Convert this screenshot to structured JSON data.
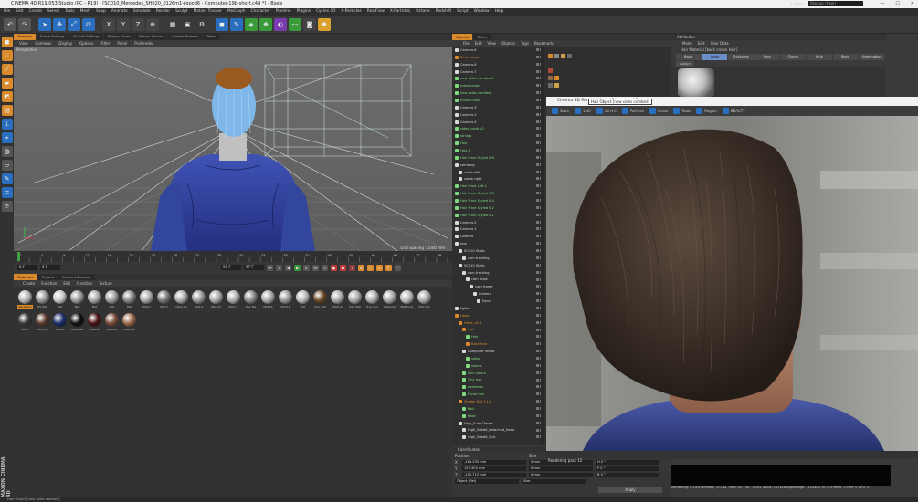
{
  "window": {
    "title": "CINEMA 4D R19.053 Studio (RC - R19) - [SC010_Mercedes_SH020_0126m1+good6 - Computer-19b-short.c4d *] - Basis"
  },
  "menubar": [
    "File",
    "Edit",
    "Create",
    "Select",
    "Tools",
    "Mesh",
    "Snap",
    "Animate",
    "Simulate",
    "Render",
    "Sculpt",
    "Motion Tracker",
    "MoGraph",
    "Character",
    "Pipeline",
    "Plugins",
    "Cycles 4D",
    "X-Particles",
    "RealFlow",
    "X-Particles",
    "Octane",
    "Redshift",
    "Script",
    "Window",
    "Help"
  ],
  "layout": {
    "label": "Layout:",
    "value": "Startup (User)"
  },
  "toolbar": {
    "icons": [
      "undo-icon",
      "redo-icon",
      "pointer-icon",
      "move-icon",
      "scale-icon",
      "rotate-icon",
      "x-axis-icon",
      "y-axis-icon",
      "z-axis-icon",
      "world-coord-icon",
      "render-region-icon",
      "render-view-icon",
      "render-settings-icon",
      "cube-icon",
      "pen-icon",
      "subdivision-icon",
      "cloner-icon",
      "deformer-icon",
      "floor-icon",
      "camera-icon",
      "light-icon"
    ]
  },
  "viewport": {
    "tabs": [
      "Viewport",
      "Scene Settings",
      "UV Edit Settings",
      "Poligon Forms",
      "Motion Tracker",
      "Content Browser",
      "Takes"
    ],
    "menu": [
      "View",
      "Cameras",
      "Display",
      "Options",
      "Filter",
      "Panel",
      "ProRender"
    ],
    "label": "Perspective",
    "grid_spacing": "Grid Spacing : 1000 mm"
  },
  "timeline": {
    "ticks": [
      "0",
      "2",
      "4",
      "6",
      "8",
      "10",
      "12",
      "14",
      "16",
      "18",
      "20",
      "22",
      "24",
      "26",
      "28",
      "30",
      "32",
      "34",
      "36",
      "38",
      "40",
      "42",
      "44",
      "46",
      "48",
      "50",
      "52",
      "54",
      "56",
      "58",
      "60",
      "62",
      "64",
      "66",
      "68",
      "70",
      "72",
      "74",
      "76",
      "78"
    ],
    "start": "0 F",
    "frame": "0 F",
    "end": "90 F",
    "current": "97 F"
  },
  "materials": {
    "tabs": [
      "Materials",
      "Octane",
      "Content Browser"
    ],
    "menu": [
      "Create",
      "Function",
      "Edit",
      "Function",
      "Texture"
    ],
    "items": [
      {
        "label": "back skin",
        "color": "#b9b9b9",
        "selected": true
      },
      {
        "label": "RS Mat",
        "color": "#9a9a9a",
        "selected": false
      },
      {
        "label": "Mat",
        "color": "#c9c9c9",
        "selected": false
      },
      {
        "label": "Mat",
        "color": "#9a9a9a",
        "selected": false
      },
      {
        "label": "Mat",
        "color": "#a8a8a8",
        "selected": false
      },
      {
        "label": "Mat",
        "color": "#9f9f9f",
        "selected": false
      },
      {
        "label": "Mat",
        "color": "#888",
        "selected": false
      },
      {
        "label": "Mat.2",
        "color": "#aaa",
        "selected": false
      },
      {
        "label": "Mat.3",
        "color": "#777",
        "selected": false
      },
      {
        "label": "shine ha",
        "color": "#aaa",
        "selected": false
      },
      {
        "label": "Mat.4",
        "color": "#999",
        "selected": false
      },
      {
        "label": "Mat.10",
        "color": "#aaa",
        "selected": false
      },
      {
        "label": "Mat.11",
        "color": "#b0b0b0",
        "selected": false
      },
      {
        "label": "Hair Ma",
        "color": "#888",
        "selected": false
      },
      {
        "label": "Mat.15",
        "color": "#aaa",
        "selected": false
      },
      {
        "label": "Mat.18",
        "color": "#999",
        "selected": false
      },
      {
        "label": "Mat",
        "color": "#bbb",
        "selected": false
      },
      {
        "label": "hair mat",
        "color": "#6b4a2a",
        "selected": false
      },
      {
        "label": "Matcut",
        "color": "#aaa",
        "selected": false
      },
      {
        "label": "Hair Mat",
        "color": "#aaa",
        "selected": false
      },
      {
        "label": "Troy hair",
        "color": "#aaa",
        "selected": false
      },
      {
        "label": "Material",
        "color": "#aaa",
        "selected": false
      },
      {
        "label": "Mat.body",
        "color": "#bbb",
        "selected": false
      },
      {
        "label": "Mat.hair",
        "color": "#aaa",
        "selected": false
      },
      {
        "label": "Mat.1",
        "color": "#3a3a3a",
        "selected": false
      },
      {
        "label": "hair_mat",
        "color": "#5a3a2a",
        "selected": false
      },
      {
        "label": "RSMat",
        "color": "#1d2d6b",
        "selected": false
      },
      {
        "label": "Mat.plast",
        "color": "#111",
        "selected": false
      },
      {
        "label": "Material",
        "color": "#4a1212",
        "selected": false
      },
      {
        "label": "Material",
        "color": "#7a4b3a",
        "selected": false
      },
      {
        "label": "Material",
        "color": "#9a6a4a",
        "selected": false
      }
    ]
  },
  "objects": {
    "tabs": [
      "Objects",
      "Takes"
    ],
    "menu": [
      "File",
      "Edit",
      "View",
      "Objects",
      "Tags",
      "Bookmarks"
    ],
    "rows": [
      {
        "label": "Camera.8",
        "indent": 0,
        "color": "#d9d9d9"
      },
      {
        "label": "Back crown",
        "indent": 0,
        "color": "#d98a2b"
      },
      {
        "label": "Camera.6",
        "indent": 0,
        "color": "#d9d9d9"
      },
      {
        "label": "Camera.7",
        "indent": 0,
        "color": "#d9d9d9"
      },
      {
        "label": "new sides combed.1",
        "indent": 0,
        "color": "#7fd97f"
      },
      {
        "label": "mesh crown",
        "indent": 0,
        "color": "#7fd97f"
      },
      {
        "label": "new sides combed",
        "indent": 0,
        "color": "#7fd97f"
      },
      {
        "label": "moon crown",
        "indent": 0,
        "color": "#7fd97f"
      },
      {
        "label": "Camera.3",
        "indent": 0,
        "color": "#d9d9d9"
      },
      {
        "label": "Camera.2",
        "indent": 0,
        "color": "#d9d9d9"
      },
      {
        "label": "Camera.4",
        "indent": 0,
        "color": "#d9d9d9"
      },
      {
        "label": "sides comb v2",
        "indent": 0,
        "color": "#7fd97f"
      },
      {
        "label": "strings",
        "indent": 0,
        "color": "#7fd97f"
      },
      {
        "label": "Hair",
        "indent": 0,
        "color": "#7fd97f"
      },
      {
        "label": "Hair.1",
        "indent": 0,
        "color": "#7fd97f"
      },
      {
        "label": "Hair Front Styled 6.6",
        "indent": 0,
        "color": "#7fd97f"
      },
      {
        "label": "combing",
        "indent": 0,
        "color": "#d9d9d9"
      },
      {
        "label": "comb left",
        "indent": 1,
        "color": "#d9d9d9"
      },
      {
        "label": "comb right",
        "indent": 1,
        "color": "#d9d9d9"
      },
      {
        "label": "Hair Front Left.1",
        "indent": 0,
        "color": "#7fd97f"
      },
      {
        "label": "Hair Front Styled 6.3",
        "indent": 0,
        "color": "#7fd97f"
      },
      {
        "label": "Hair Front Styled 6.4",
        "indent": 0,
        "color": "#7fd97f"
      },
      {
        "label": "Hair Front Styled 6.2",
        "indent": 0,
        "color": "#7fd97f"
      },
      {
        "label": "Hair Front Styled 6.1",
        "indent": 0,
        "color": "#7fd97f"
      },
      {
        "label": "Camera.5",
        "indent": 0,
        "color": "#d9d9d9"
      },
      {
        "label": "Camera.1",
        "indent": 0,
        "color": "#d9d9d9"
      },
      {
        "label": "Camera",
        "indent": 0,
        "color": "#d9d9d9"
      },
      {
        "label": "rem",
        "indent": 0,
        "color": "#d9d9d9"
      },
      {
        "label": "SC010 Static",
        "indent": 1,
        "color": "#d9d9d9"
      },
      {
        "label": "cam tracking",
        "indent": 2,
        "color": "#d9d9d9"
      },
      {
        "label": "SC010 Static",
        "indent": 1,
        "color": "#d9d9d9"
      },
      {
        "label": "cam tracking",
        "indent": 2,
        "color": "#d9d9d9"
      },
      {
        "label": "cam pivot",
        "indent": 3,
        "color": "#d9d9d9"
      },
      {
        "label": "cam frame",
        "indent": 4,
        "color": "#d9d9d9"
      },
      {
        "label": "Camera",
        "indent": 5,
        "color": "#d9d9d9"
      },
      {
        "label": "Focus",
        "indent": 6,
        "color": "#d9d9d9"
      },
      {
        "label": "lights",
        "indent": 0,
        "color": "#d9d9d9"
      },
      {
        "label": "Head",
        "indent": 0,
        "color": "#d98a2b"
      },
      {
        "label": "Head_v6.4",
        "indent": 1,
        "color": "#d98a2b"
      },
      {
        "label": "Hair",
        "indent": 2,
        "color": "#d98a2b"
      },
      {
        "label": "Hair",
        "indent": 3,
        "color": "#7fd97f"
      },
      {
        "label": "Back Hair",
        "indent": 3,
        "color": "#d98a2b"
      },
      {
        "label": "Computer forest",
        "indent": 2,
        "color": "#d9d9d9"
      },
      {
        "label": "sides",
        "indent": 3,
        "color": "#7fd97f"
      },
      {
        "label": "sholds",
        "indent": 3,
        "color": "#7fd97f"
      },
      {
        "label": "Skin velour",
        "indent": 2,
        "color": "#7fd97f"
      },
      {
        "label": "Tiny hair",
        "indent": 2,
        "color": "#7fd97f"
      },
      {
        "label": "eyebrows",
        "indent": 2,
        "color": "#7fd97f"
      },
      {
        "label": "Facial hair",
        "indent": 2,
        "color": "#7fd97f"
      },
      {
        "label": "Shader Ball 11.1",
        "indent": 1,
        "color": "#d98a2b"
      },
      {
        "label": "Ball",
        "indent": 2,
        "color": "#7fd97f"
      },
      {
        "label": "Base",
        "indent": 2,
        "color": "#7fd97f"
      },
      {
        "label": "High_Suba Dense",
        "indent": 1,
        "color": "#d9d9d9"
      },
      {
        "label": "High_Subdd_detached_head",
        "indent": 2,
        "color": "#d9d9d9"
      },
      {
        "label": "High_Subdd_Suit",
        "indent": 2,
        "color": "#d9d9d9"
      }
    ]
  },
  "coordinates": {
    "header": "Coordinates",
    "col_headers": [
      "Position",
      "Size",
      "Rotation"
    ],
    "rows": [
      {
        "axis": "X",
        "pos": "-166.255 mm",
        "size": "0 mm",
        "rot": "H  0 °"
      },
      {
        "axis": "Y",
        "pos": "159.305 mm",
        "size": "0 mm",
        "rot": "P  0 °"
      },
      {
        "axis": "Z",
        "pos": "-132.712 mm",
        "size": "0 mm",
        "rot": "B  0 °"
      }
    ],
    "mode": "Object (Rel)",
    "size_mode": "Size",
    "apply": "Apply"
  },
  "attributes": {
    "header": "Attributes",
    "menu": [
      "Mode",
      "Edit",
      "User Data"
    ],
    "title": "Hair Material [back crown Hair]",
    "tabs": [
      "Basic",
      "Color",
      "Thickness",
      "Frizz",
      "Clump",
      "Kink",
      "Bend",
      "Illumination"
    ],
    "active_tab": "Color",
    "assign": "Assign"
  },
  "renderview": {
    "title": "Cinema 4D Render View - Computer / Frame",
    "tooltip": "Hair Object [new sides combed]",
    "toolbar": [
      "Save",
      "1:40",
      "Ctrl+C",
      "Refresh",
      "Erase",
      "Tools",
      "Region",
      "BEAUTY"
    ],
    "pass": "Rendering pass 12",
    "info": "Rendering: 0.24%   Memory: 371.81   Time: 00 : 00 : 03:61   Spp/s: 117428   Spp/image: 1124400   Tri: 0.0   Mesh: 0   Hair: 0   GPU: 0"
  },
  "statusbar": "Hair Object [new sides combed]"
}
